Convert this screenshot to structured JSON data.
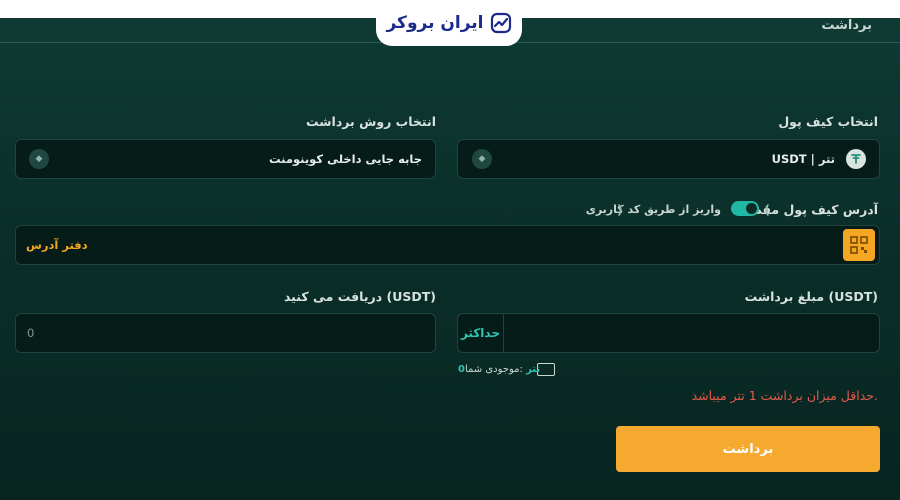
{
  "header": {
    "logo_text": "ایران بروکر",
    "title": "برداشت"
  },
  "wallet_select": {
    "label": "انتخاب کیف پول",
    "value": "USDT | تتر"
  },
  "method_select": {
    "label": "انتخاب روش برداشت",
    "value": "جابه جایی داخلی کوینومنت"
  },
  "destination": {
    "label": "آدرس کیف پول مقصد",
    "toggle_label": "واریز از طریق کد کاربری",
    "toggle_on": true,
    "address_book_label": "دفتر آدرس"
  },
  "amount": {
    "label": "مبلغ برداشت (USDT)",
    "max_label": "حداکثر",
    "balance_label": ":موجودی شما",
    "balance_value": "0",
    "balance_unit": "تتر"
  },
  "receive": {
    "label": "دریافت می کنید (USDT)",
    "value": "0"
  },
  "error_text": "حداقل میزان برداشت 1 تتر میباشد.",
  "submit_label": "برداشت",
  "colors": {
    "accent": "#2fc4b0",
    "warning": "#f5a623",
    "error": "#e25b4b",
    "brand": "#1b2b8c"
  }
}
